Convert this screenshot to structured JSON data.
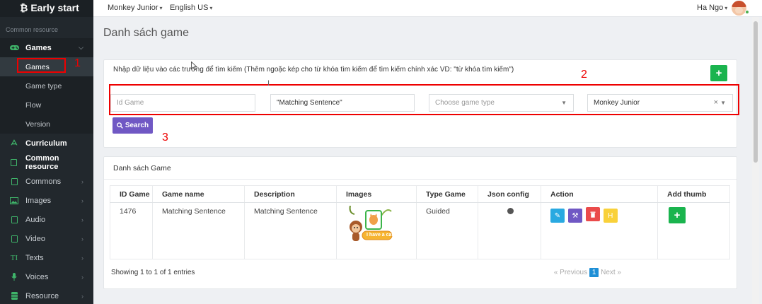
{
  "brand": {
    "label": "Early start",
    "icon": "bitcoin-icon"
  },
  "sidebar": {
    "header": "Common resource",
    "items": [
      {
        "label": "Games",
        "icon": "gamepad-icon",
        "expanded": true
      },
      {
        "label": "Games",
        "sub": true,
        "active": true
      },
      {
        "label": "Game type",
        "sub": true
      },
      {
        "label": "Flow",
        "sub": true
      },
      {
        "label": "Version",
        "sub": true
      },
      {
        "label": "Curriculum",
        "icon": "curriculum-icon"
      },
      {
        "label": "Common resource",
        "icon": "file-icon"
      },
      {
        "label": "Commons",
        "icon": "file-icon"
      },
      {
        "label": "Images",
        "icon": "image-icon"
      },
      {
        "label": "Audio",
        "icon": "audio-file-icon"
      },
      {
        "label": "Video",
        "icon": "video-file-icon"
      },
      {
        "label": "Texts",
        "icon": "text-icon"
      },
      {
        "label": "Voices",
        "icon": "mic-icon"
      },
      {
        "label": "Resource",
        "icon": "database-icon"
      }
    ]
  },
  "topbar": {
    "app_menu": "Monkey Junior",
    "lang_menu": "English US",
    "user": "Ha Ngo"
  },
  "page": {
    "title": "Danh sách game"
  },
  "search": {
    "hint": "Nhập dữ liệu vào các trường để tìm kiếm (Thêm ngoặc kép cho từ khóa tìm kiếm để tìm kiếm chính xác VD: \"từ khóa tìm kiếm\")",
    "id_placeholder": "Id Game",
    "name_value": "\"Matching Sentence\"",
    "type_placeholder": "Choose game type",
    "app_value": "Monkey Junior",
    "button_label": "Search"
  },
  "annotations": {
    "one": "1",
    "two": "2",
    "three": "3"
  },
  "list": {
    "title": "Danh sách Game",
    "columns": [
      "ID Game",
      "Game name",
      "Description",
      "Images",
      "Type Game",
      "Json config",
      "Action",
      "Add thumb"
    ],
    "rows": [
      {
        "id": "1476",
        "name": "Matching Sentence",
        "description": "Matching Sentence",
        "image_caption": "I have a cat",
        "type": "Guided",
        "action_h_label": "H"
      }
    ],
    "showing": "Showing 1 to 1 of 1 entries",
    "pager": {
      "prev": "« Previous",
      "page": "1",
      "next": "Next »"
    }
  },
  "colors": {
    "sidebar": "#22282d",
    "accent_green": "#1ab44e",
    "search_purple": "#7058c4",
    "annotation_red": "#ee0000"
  }
}
